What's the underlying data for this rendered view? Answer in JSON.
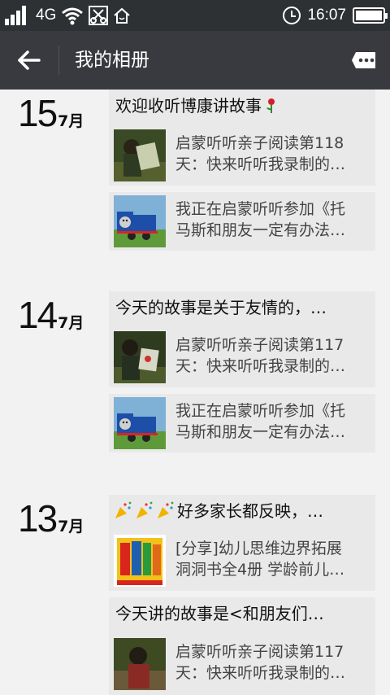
{
  "status": {
    "network": "4G",
    "time": "16:07",
    "battery_level": 1.0
  },
  "header": {
    "title": "我的相册",
    "icons": [
      "back-arrow-icon",
      "more-icon"
    ]
  },
  "days": [
    {
      "day": "15",
      "month": "7月",
      "posts": [
        {
          "type": "text",
          "text": "欢迎收听博康讲故事",
          "icon": "rose-icon"
        },
        {
          "type": "link",
          "thumb": "child-reading-photo",
          "line1": "启蒙听听亲子阅读第118",
          "line2": "天：快来听听我录制的…"
        },
        {
          "type": "link",
          "thumb": "thomas-train-image",
          "line1": "我正在启蒙听听参加《托",
          "line2": "马斯和朋友一定有办法…"
        }
      ]
    },
    {
      "day": "14",
      "month": "7月",
      "posts": [
        {
          "type": "text",
          "text": "今天的故事是关于友情的，…"
        },
        {
          "type": "link",
          "thumb": "child-reading-photo",
          "line1": "启蒙听听亲子阅读第117",
          "line2": "天：快来听听我录制的…"
        },
        {
          "type": "link",
          "thumb": "thomas-train-image",
          "line1": "我正在启蒙听听参加《托",
          "line2": "马斯和朋友一定有办法…"
        }
      ]
    },
    {
      "day": "13",
      "month": "7月",
      "posts": [
        {
          "type": "text",
          "text": "好多家长都反映，…",
          "icon": "party-popper-icon"
        },
        {
          "type": "link",
          "thumb": "book-cover-image",
          "line1": "[分享]幼儿思维边界拓展",
          "line2": "洞洞书全4册 学龄前儿…"
        },
        {
          "type": "text",
          "text": "今天讲的故事是<和朋友们…"
        },
        {
          "type": "link",
          "thumb": "child-reading-photo",
          "line1": "启蒙听听亲子阅读第117",
          "line2": "天：快来听听我录制的…"
        }
      ]
    }
  ]
}
